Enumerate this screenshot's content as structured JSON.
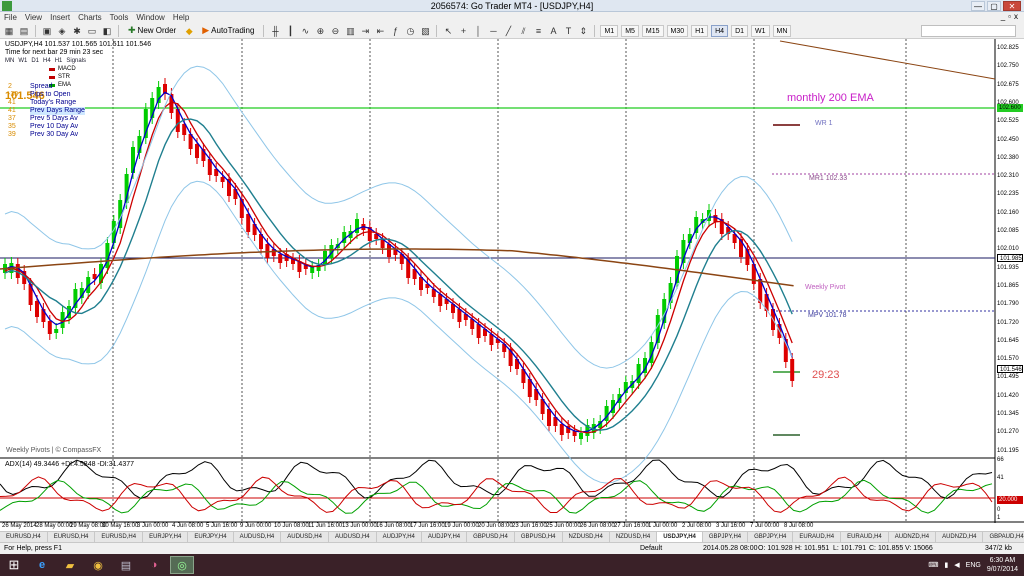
{
  "window": {
    "title": "2056574: Go Trader MT4 - [USDJPY,H4]",
    "controls": [
      "—",
      "▢",
      "✕"
    ]
  },
  "menu": {
    "items": [
      "File",
      "View",
      "Insert",
      "Charts",
      "Tools",
      "Window",
      "Help"
    ],
    "right_controls": [
      "_",
      "▫",
      "x"
    ]
  },
  "toolbar": {
    "new_order_label": "New Order",
    "autotrading_label": "AutoTrading",
    "timeframes": [
      "M1",
      "M5",
      "M15",
      "M30",
      "H1",
      "H4",
      "D1",
      "W1",
      "MN"
    ],
    "active_timeframe": "H4",
    "search_placeholder": ""
  },
  "chart": {
    "symbol_header": "USDJPY,H4  101.537 101.565 101.511 101.546",
    "time_line": "Time for next bar 29 min 23 sec",
    "hud_tabs": [
      "MN",
      "W1",
      "D1",
      "H4",
      "H1",
      "Signals"
    ],
    "legend": [
      {
        "label": "MACD",
        "color": "#c00000"
      },
      {
        "label": "STR",
        "color": "#c00000"
      },
      {
        "label": "EMA",
        "color": "#00a000"
      }
    ],
    "bid_display": "101.546",
    "stats": [
      {
        "num": "2",
        "label": "Spread"
      },
      {
        "num": "-30",
        "label": "Pips to Open"
      },
      {
        "num": "41",
        "label": "Today's Range"
      },
      {
        "num": "41",
        "label": "Prev Days Range"
      },
      {
        "num": "37",
        "label": "Prev 5 Days Av"
      },
      {
        "num": "35",
        "label": "Prev 10 Day Av"
      },
      {
        "num": "39",
        "label": "Prev 30 Day Av"
      }
    ],
    "annotation_monthly": "monthly 200 EMA",
    "annotation_wr1": "WR 1",
    "annotation_mr1": "MR1  102.33",
    "annotation_weekly_pivot": "Weekly Pivot",
    "annotation_mpv": "MPV  101.78",
    "countdown": "29:23",
    "pivot_source": "Weekly Pivots | © CompassFX",
    "adx_label": "ADX(14) 49.3446 +DI:4.5848 -DI:31.4377",
    "price_axis": [
      "102.825",
      "102.750",
      "102.675",
      "102.600",
      "102.525",
      "102.450",
      "102.380",
      "102.310",
      "102.235",
      "102.160",
      "102.085",
      "102.010",
      "101.935",
      "101.865",
      "101.790",
      "101.720",
      "101.645",
      "101.570",
      "101.495",
      "101.420",
      "101.345",
      "101.270",
      "101.195"
    ],
    "price_tags": [
      {
        "label": "102.600",
        "color": "#22cc22"
      },
      {
        "label": "101.985",
        "color": "#ffffff"
      },
      {
        "label": "101.546",
        "color": "#ffffff"
      }
    ],
    "adx_axis": [
      "66",
      "41",
      "20",
      "0",
      "1"
    ],
    "adx_tag": "20.000",
    "time_axis": [
      "26 May 2014",
      "28 May 00:00",
      "29 May 08:00",
      "30 May 16:00",
      "3 Jun 00:00",
      "4 Jun 08:00",
      "5 Jun 16:00",
      "9 Jun 00:00",
      "10 Jun 08:00",
      "11 Jun 16:00",
      "13 Jun 00:00",
      "16 Jun 08:00",
      "17 Jun 16:00",
      "19 Jun 00:00",
      "20 Jun 08:00",
      "23 Jun 16:00",
      "25 Jun 00:00",
      "26 Jun 08:00",
      "27 Jun 16:00",
      "1 Jul 00:00",
      "2 Jul 08:00",
      "3 Jul 16:00",
      "7 Jul 00:00",
      "8 Jul 08:00"
    ],
    "colors": {
      "bull": "#00cc00",
      "bear": "#dd0000",
      "ema_red": "#cc0000",
      "ema_teal": "#1f7f8f",
      "ema_blue": "#0000cc",
      "ema200": "#8b4513",
      "bands": "#8fc6e8",
      "monthly_ema": "#22cc22"
    }
  },
  "symbol_tabs": [
    "EURUSD,H4",
    "EURUSD,H4",
    "EURUSD,H4",
    "EURJPY,H4",
    "EURJPY,H4",
    "AUDUSD,H4",
    "AUDUSD,H4",
    "AUDUSD,H4",
    "AUDJPY,H4",
    "AUDJPY,H4",
    "GBPUSD,H4",
    "GBPUSD,H4",
    "NZDUSD,H4",
    "NZDUSD,H4",
    "USDJPY,H4",
    "GBPJPY,H4",
    "GBPJPY,H4",
    "EURAUD,H4",
    "EURAUD,H4",
    "AUDNZD,H4",
    "AUDNZD,H4",
    "GBPAUD,H4"
  ],
  "active_symbol_tab": "USDJPY,H4",
  "status": {
    "help": "For Help, press F1",
    "profile": "Default",
    "datetime": "2014.05.28 08:00",
    "open": "O: 101.928",
    "high": "H: 101.951",
    "low": "L: 101.791",
    "close": "C: 101.855",
    "volume": "V: 15066",
    "traffic": "347/2 kb"
  },
  "taskbar": {
    "time": "6:30 AM",
    "date": "9/07/2014",
    "lang": "ENG"
  }
}
